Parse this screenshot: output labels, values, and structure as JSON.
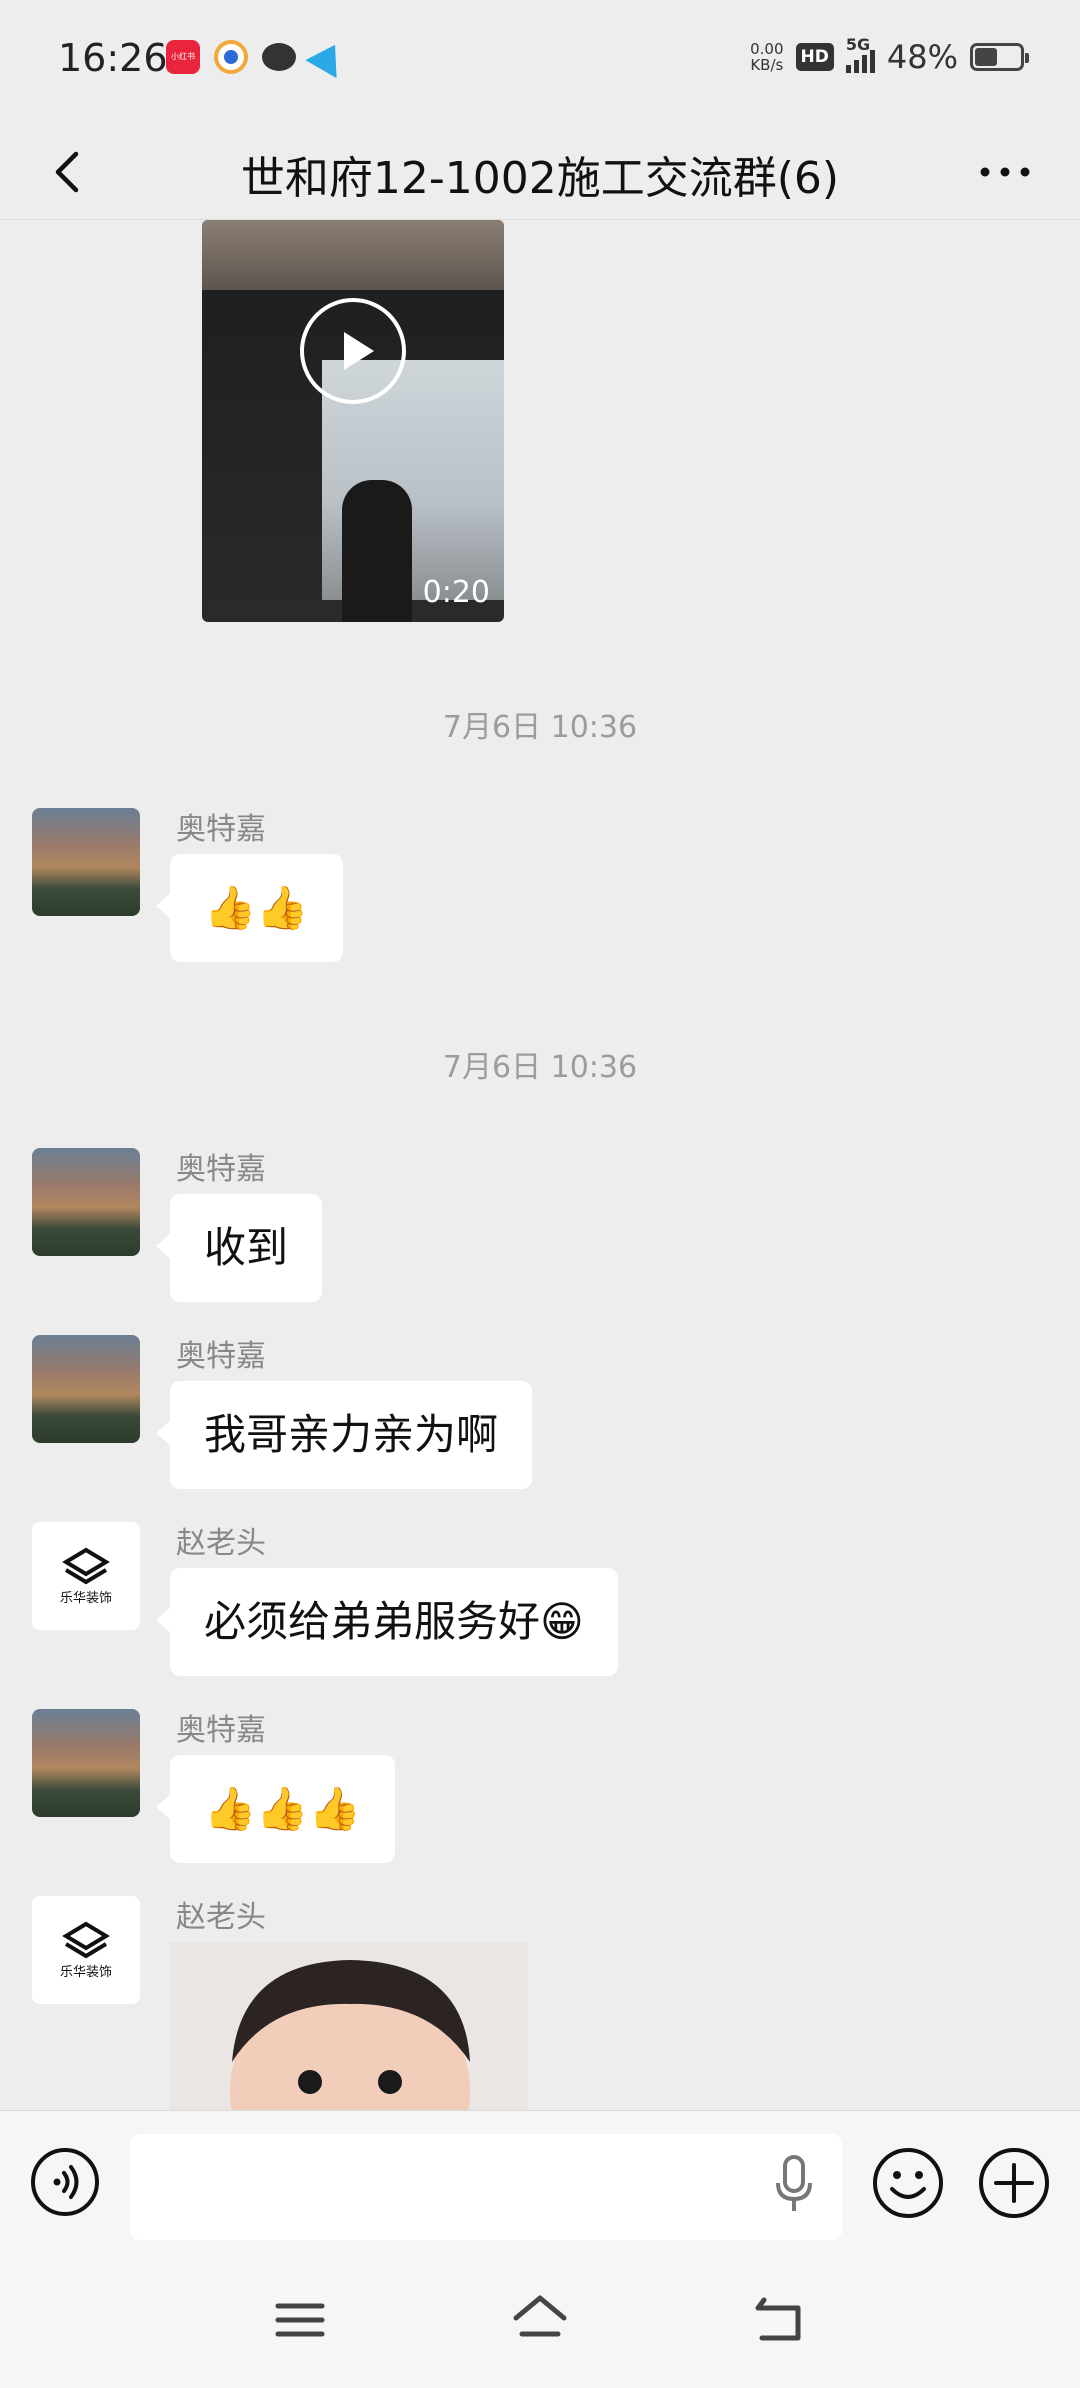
{
  "status_bar": {
    "time": "16:26",
    "net_speed_value": "0.00",
    "net_speed_unit": "KB/s",
    "hd": "HD",
    "network": "5G",
    "battery_percent": "48%",
    "app_badge_text": "小红书"
  },
  "title_bar": {
    "title": "世和府12-1002施工交流群(6)"
  },
  "messages": [
    {
      "type": "video",
      "duration": "0:20"
    },
    {
      "type": "timestamp",
      "text": "7月6日 10:36"
    },
    {
      "type": "text",
      "sender": "奥特嘉",
      "text": "👍👍"
    },
    {
      "type": "timestamp",
      "text": "7月6日 10:36"
    },
    {
      "type": "text",
      "sender": "奥特嘉",
      "text": "收到"
    },
    {
      "type": "text",
      "sender": "奥特嘉",
      "text": "我哥亲力亲为啊"
    },
    {
      "type": "text",
      "sender": "赵老头",
      "text": "必须给弟弟服务好😁"
    },
    {
      "type": "text",
      "sender": "奥特嘉",
      "text": "👍👍👍"
    },
    {
      "type": "image",
      "sender": "赵老头"
    }
  ],
  "logo": {
    "text": "乐华装饰"
  },
  "colors": {
    "background": "#EDEDED",
    "bubble": "#FFFFFF",
    "timestamp": "#9C9C9C",
    "sender": "#888888"
  }
}
